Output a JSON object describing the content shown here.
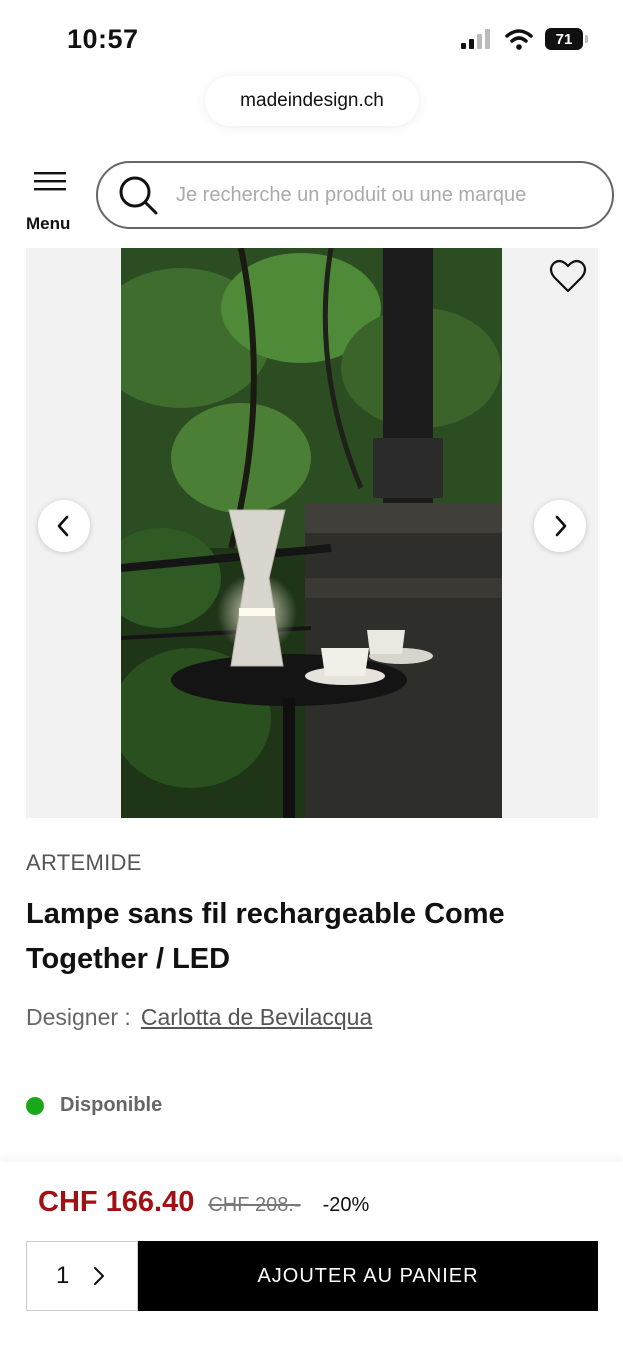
{
  "status_bar": {
    "time": "10:57",
    "battery": "71"
  },
  "browser": {
    "url": "madeindesign.ch"
  },
  "header": {
    "menu_label": "Menu",
    "search_placeholder": "Je recherche un produit ou une marque"
  },
  "product": {
    "brand": "ARTEMIDE",
    "title": "Lampe sans fil rechargeable Come Together / LED",
    "designer_label": "Designer :",
    "designer_name": "Carlotta de Bevilacqua",
    "availability": "Disponible",
    "availability_color": "#1aa81a",
    "image_alt": "Lampe Come Together sur une table ronde avec des tasses, dans un jardin"
  },
  "pricing": {
    "current": "CHF 166.40",
    "original": "CHF 208.-",
    "discount": "-20%",
    "price_color": "#a11014"
  },
  "cart": {
    "quantity": "1",
    "add_label": "AJOUTER AU PANIER"
  },
  "icons": {
    "menu": "hamburger-icon",
    "search": "search-icon",
    "favorite": "heart-icon",
    "prev": "chevron-left-icon",
    "next": "chevron-right-icon"
  }
}
